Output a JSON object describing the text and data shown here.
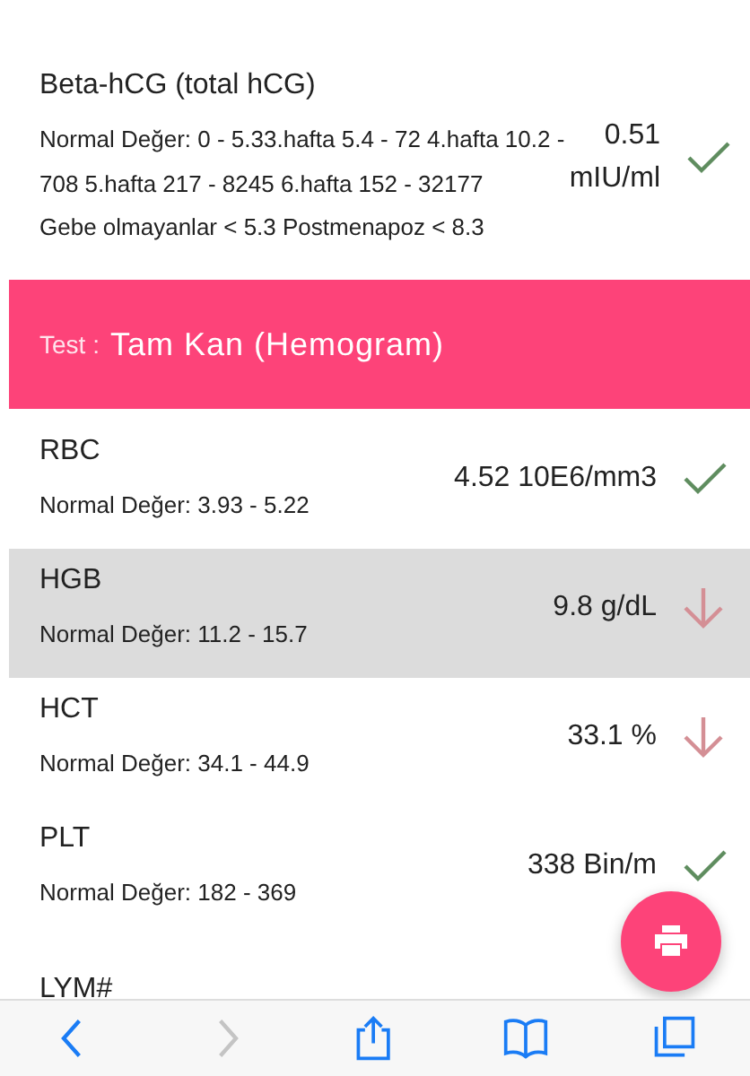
{
  "tests": [
    {
      "kind": "result",
      "name": "Beta-hCG (total hCG)",
      "ranges": [
        "Normal Değer: 0 - 5.33.hafta 5.4 - 72 4.hafta 10.2 - 708 5.hafta 217 - 8245 6.hafta 152 - 32177",
        "Gebe olmayanlar < 5.3 Postmenapoz < 8.3"
      ],
      "value": "0.51 mIU/ml",
      "low": false,
      "highlighted": false
    },
    {
      "kind": "header",
      "prefix": "Test :",
      "title": "Tam Kan (Hemogram)"
    },
    {
      "kind": "result",
      "name": "RBC",
      "ranges": [
        "Normal Değer: 3.93 - 5.22"
      ],
      "value": "4.52 10E6/mm3",
      "low": false,
      "highlighted": false
    },
    {
      "kind": "result",
      "name": "HGB",
      "ranges": [
        "Normal Değer: 11.2 - 15.7"
      ],
      "value": "9.8 g/dL",
      "low": true,
      "highlighted": true
    },
    {
      "kind": "result",
      "name": "HCT",
      "ranges": [
        "Normal Değer: 34.1 - 44.9"
      ],
      "value": "33.1 %",
      "low": true,
      "highlighted": false
    },
    {
      "kind": "result",
      "name": "PLT",
      "ranges": [
        "Normal Değer: 182 - 369"
      ],
      "value": "338 Bin/m",
      "low": false,
      "highlighted": false
    },
    {
      "kind": "result",
      "name": "LYM#",
      "highlighted": false
    }
  ],
  "toolbar": [
    {
      "kind": "back",
      "disabled": false
    },
    {
      "kind": "forward",
      "disabled": true
    },
    {
      "kind": "share",
      "disabled": false
    },
    {
      "kind": "bookmarks",
      "disabled": false
    },
    {
      "kind": "tabs",
      "disabled": false
    }
  ]
}
